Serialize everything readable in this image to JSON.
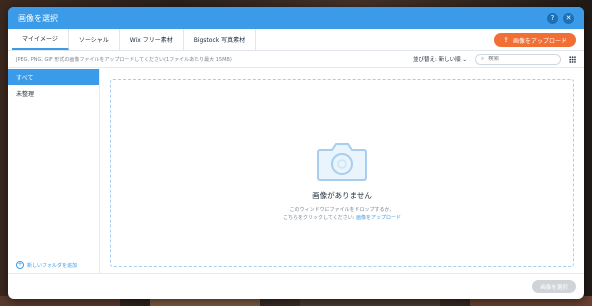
{
  "header": {
    "title": "画像を選択",
    "help_icon": "?",
    "close_icon": "✕"
  },
  "tabs": [
    {
      "label": "マイイメージ",
      "active": true
    },
    {
      "label": "ソーシャル"
    },
    {
      "label": "Wix フリー素材"
    },
    {
      "label": "Bigstock 写真素材"
    }
  ],
  "upload_button": {
    "label": "画像をアップロード",
    "icon": "upload-icon"
  },
  "infobar": {
    "info": "JPEG, PNG, GIF 形式の画像ファイルをアップロードしてください(1ファイルあたり最大 15MB)",
    "sort": "並び替え: 新しい順",
    "search_placeholder": "検索"
  },
  "sidebar": {
    "items": [
      {
        "label": "すべて",
        "active": true
      },
      {
        "label": "未整理"
      }
    ],
    "new_folder": "新しいフォルダを追加"
  },
  "empty": {
    "title": "画像がありません",
    "line1": "このウィンドウにファイルをドロップするか、",
    "line2_prefix": "こちらをクリックしてください: ",
    "line2_link": "画像をアップロード"
  },
  "footer": {
    "select_button": "画像を選択"
  },
  "colors": {
    "accent": "#3b9be8",
    "upload": "#f16e34",
    "disabled": "#d0d4d8"
  }
}
